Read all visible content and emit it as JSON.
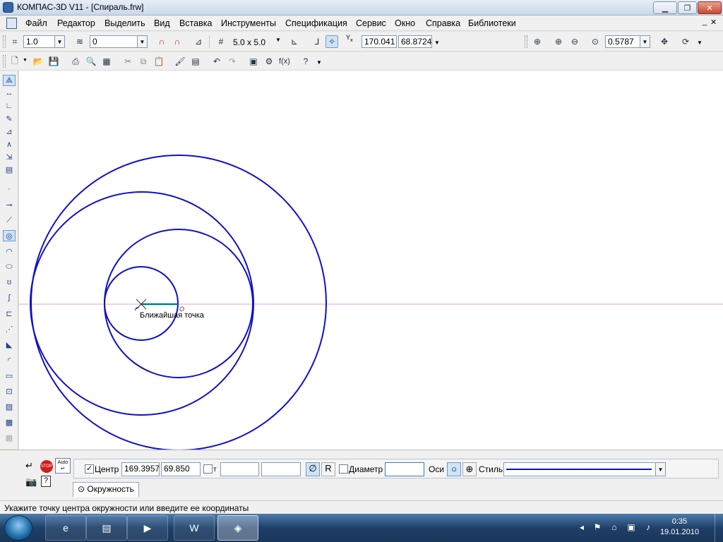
{
  "window": {
    "title": "КОМПАС-3D V11 - [Спираль.frw]"
  },
  "menu": {
    "items": [
      "Файл",
      "Редактор",
      "Выделить",
      "Вид",
      "Вставка",
      "Инструменты",
      "Спецификация",
      "Сервис",
      "Окно",
      "Справка",
      "Библиотеки"
    ]
  },
  "toolbar1": {
    "step_value": "1.0",
    "layer_value": "0",
    "grid_value": "5.0 x 5.0",
    "cursor_x": "170.041",
    "cursor_y": "68.8724",
    "zoom_value": "0.5787"
  },
  "canvas": {
    "hint_label": "Ближайшая точка",
    "colors": {
      "circle": "#1010c8",
      "axis": "#d8a8d8",
      "radius": "#008080"
    }
  },
  "propbar": {
    "center_label": "Центр",
    "center_x": "169.3957",
    "center_y": "69.850",
    "point_label": "т",
    "point_x": "",
    "point_y": "",
    "diameter_symbol": "∅",
    "radius_symbol": "R",
    "diameter_label": "Диаметр",
    "diameter_value": "",
    "axes_label": "Оси",
    "style_label": "Стиль",
    "stop_label": "STOP",
    "auto_label": "Auto",
    "tab_label": "Окружность"
  },
  "status": {
    "text": "Укажите точку центра окружности или введите ее координаты"
  },
  "taskbar": {
    "time": "0:35",
    "date": "19.01.2010"
  }
}
